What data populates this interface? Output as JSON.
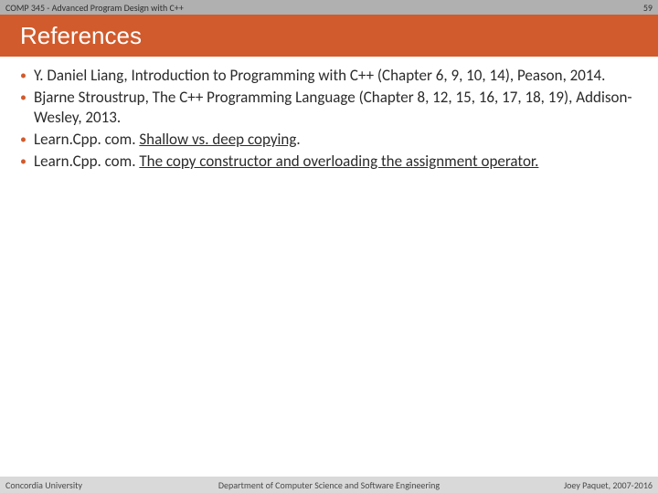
{
  "topbar": {
    "course": "COMP 345 - Advanced Program Design with C++",
    "slide_number": "59"
  },
  "title": "References",
  "references": [
    {
      "text": "Y. Daniel Liang, Introduction to Programming with C++ (Chapter 6, 9, 10, 14), Peason, 2014."
    },
    {
      "text": "Bjarne Stroustrup, The C++ Programming Language (Chapter 8, 12, 15, 16, 17, 18, 19), Addison-Wesley, 2013."
    },
    {
      "prefix": "Learn.Cpp. com. ",
      "link": "Shallow vs. deep copying",
      "suffix": "."
    },
    {
      "prefix": "Learn.Cpp. com. ",
      "link": "The copy constructor and overloading the assignment operator.",
      "suffix": ""
    }
  ],
  "footer": {
    "left": "Concordia University",
    "center": "Department of Computer Science and Software Engineering",
    "right": "Joey Paquet, 2007-2016"
  }
}
